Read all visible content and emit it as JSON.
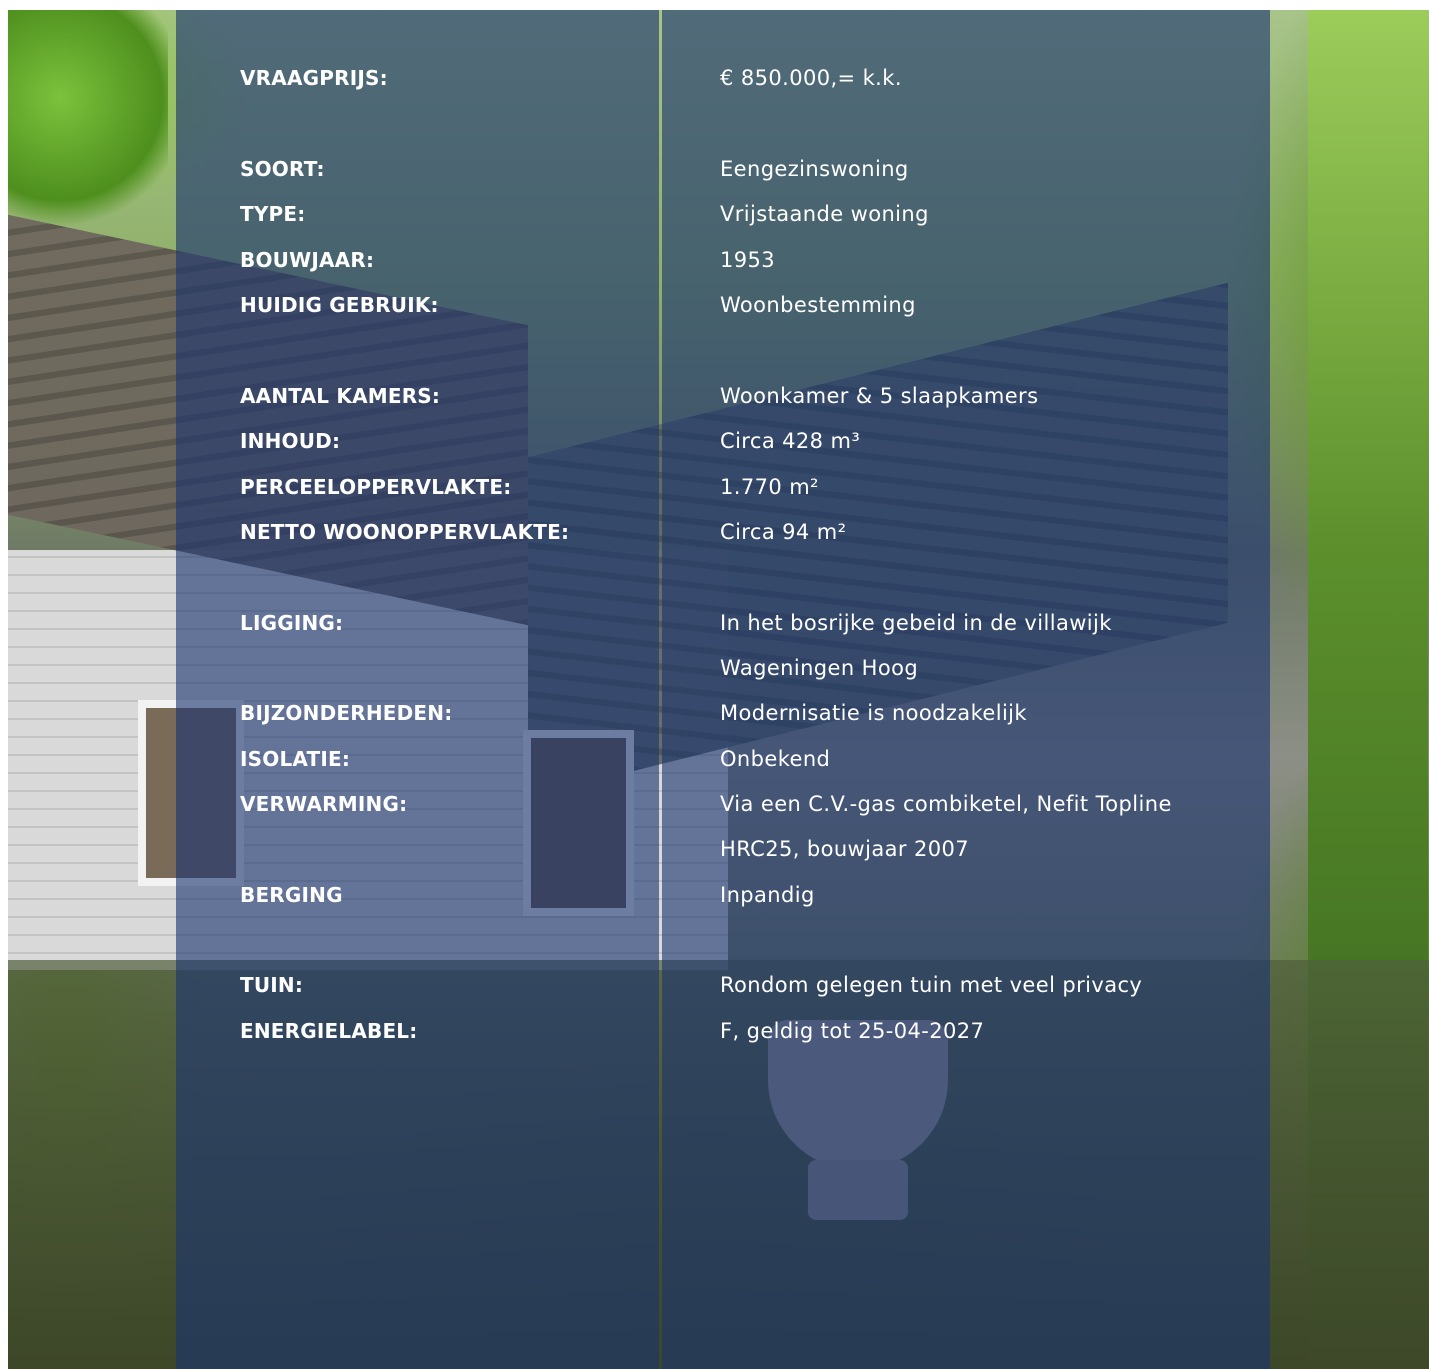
{
  "rows": [
    {
      "label": "VRAAGPRIJS:",
      "value": "€ 850.000,= k.k."
    },
    {
      "label": "SOORT:",
      "value": "Eengezinswoning"
    },
    {
      "label": "TYPE:",
      "value": "Vrijstaande woning"
    },
    {
      "label": "BOUWJAAR:",
      "value": "1953"
    },
    {
      "label": "HUIDIG GEBRUIK:",
      "value": "Woonbestemming"
    },
    {
      "label": "AANTAL KAMERS:",
      "value": "Woonkamer & 5 slaapkamers"
    },
    {
      "label": "INHOUD:",
      "value": "Circa 428 m³"
    },
    {
      "label": "PERCEELOPPERVLAKTE:",
      "value": "1.770 m²"
    },
    {
      "label": "NETTO WOONOPPERVLAKTE:",
      "value": "Circa 94 m²"
    },
    {
      "label": "LIGGING:",
      "value": "In het bosrijke gebeid in de villawijk",
      "value2": "Wageningen Hoog"
    },
    {
      "label": "BIJZONDERHEDEN:",
      "value": "Modernisatie is noodzakelijk"
    },
    {
      "label": "ISOLATIE:",
      "value": "Onbekend"
    },
    {
      "label": "VERWARMING:",
      "value": "Via een C.V.-gas combiketel, Nefit Topline",
      "value2": "HRC25, bouwjaar 2007"
    },
    {
      "label": "BERGING",
      "value": "Inpandig"
    },
    {
      "label": "TUIN:",
      "value": "Rondom gelegen tuin met veel privacy"
    },
    {
      "label": "ENERGIELABEL:",
      "value": "F, geldig tot 25-04-2027"
    }
  ],
  "colors": {
    "overlay": "#1c3470",
    "text": "#ffffff"
  }
}
